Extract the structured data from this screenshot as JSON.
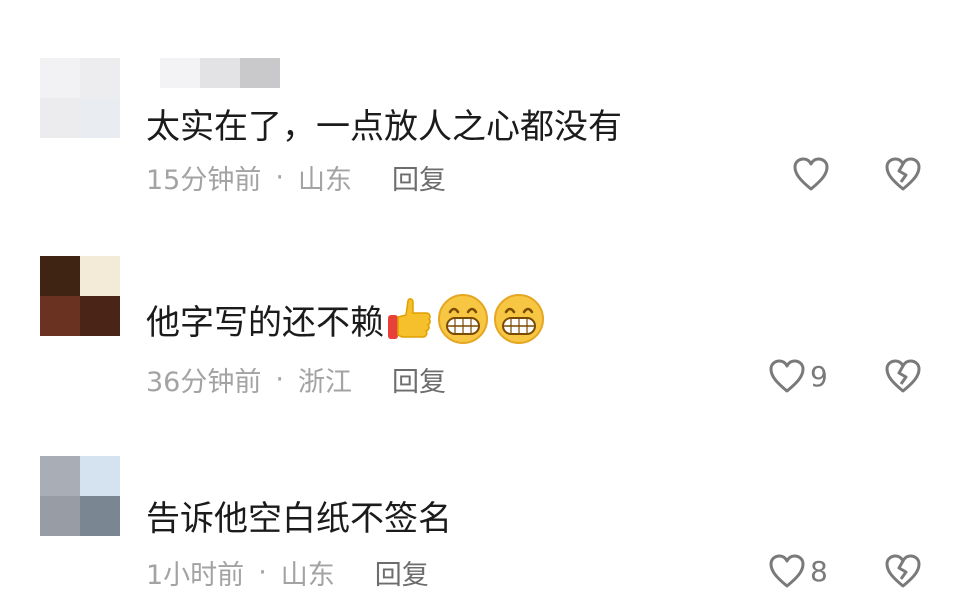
{
  "comments": [
    {
      "text": "太实在了，一点放人之心都没有",
      "time": "15分钟前",
      "location": "山东",
      "reply": "回复",
      "likes": "",
      "emojis": []
    },
    {
      "text": "他字写的还不赖",
      "time": "36分钟前",
      "location": "浙江",
      "reply": "回复",
      "likes": "9",
      "emojis": [
        "thumbs-up",
        "grin",
        "grin"
      ]
    },
    {
      "text": "告诉他空白纸不签名",
      "time": "1小时前",
      "location": "山东",
      "reply": "回复",
      "likes": "8",
      "emojis": []
    }
  ],
  "separator": "·",
  "colors": {
    "text": "#1b1b1b",
    "meta": "#a3a3a3",
    "icon": "#7a7a7a"
  }
}
